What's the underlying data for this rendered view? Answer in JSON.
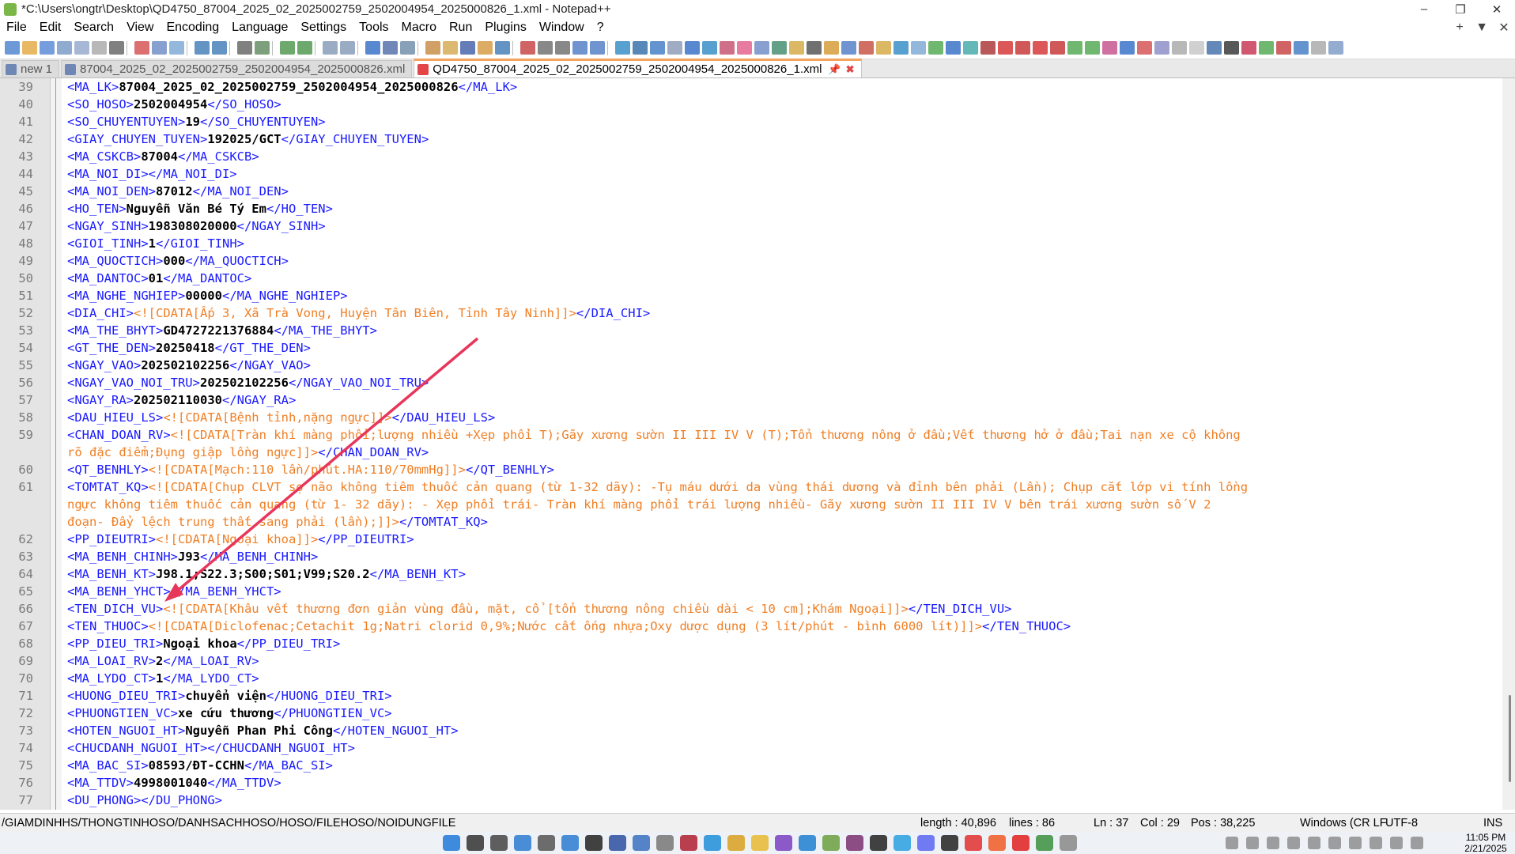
{
  "window": {
    "title": "*C:\\Users\\ongtr\\Desktop\\QD4750_87004_2025_02_2025002759_2502004954_2025000826_1.xml - Notepad++",
    "minimize": "–",
    "maximize": "❐",
    "close": "✕"
  },
  "menu": [
    "File",
    "Edit",
    "Search",
    "View",
    "Encoding",
    "Language",
    "Settings",
    "Tools",
    "Macro",
    "Run",
    "Plugins",
    "Window",
    "?"
  ],
  "menu_right": {
    "add": "+",
    "dropdown": "▼",
    "close": "✕"
  },
  "tabs": [
    {
      "label": "new 1"
    },
    {
      "label": "87004_2025_02_2025002759_2502004954_2025000826.xml"
    },
    {
      "label": "QD4750_87004_2025_02_2025002759_2502004954_2025000826_1.xml",
      "pin": "📌",
      "close": "✖"
    }
  ],
  "lines": [
    {
      "n": "39",
      "t": "MA_LK",
      "v": "87004_2025_02_2025002759_2502004954_2025000826"
    },
    {
      "n": "40",
      "t": "SO_HOSO",
      "v": "2502004954"
    },
    {
      "n": "41",
      "t": "SO_CHUYENTUYEN",
      "v": "19"
    },
    {
      "n": "42",
      "t": "GIAY_CHUYEN_TUYEN",
      "v": "192025/GCT"
    },
    {
      "n": "43",
      "t": "MA_CSKCB",
      "v": "87004"
    },
    {
      "n": "44",
      "t": "MA_NOI_DI",
      "v": ""
    },
    {
      "n": "45",
      "t": "MA_NOI_DEN",
      "v": "87012"
    },
    {
      "n": "46",
      "t": "HO_TEN",
      "v": "Nguyễn Văn Bé Tý Em"
    },
    {
      "n": "47",
      "t": "NGAY_SINH",
      "v": "198308020000"
    },
    {
      "n": "48",
      "t": "GIOI_TINH",
      "v": "1"
    },
    {
      "n": "49",
      "t": "MA_QUOCTICH",
      "v": "000"
    },
    {
      "n": "50",
      "t": "MA_DANTOC",
      "v": "01"
    },
    {
      "n": "51",
      "t": "MA_NGHE_NGHIEP",
      "v": "00000"
    },
    {
      "n": "52",
      "t": "DIA_CHI",
      "c": "<![CDATA[Ấp 3, Xã Trà Vong, Huyện Tân Biên, Tỉnh Tây Ninh]]>"
    },
    {
      "n": "53",
      "t": "MA_THE_BHYT",
      "v": "GD4727221376884"
    },
    {
      "n": "54",
      "t": "GT_THE_DEN",
      "v": "20250418"
    },
    {
      "n": "55",
      "t": "NGAY_VAO",
      "v": "202502102256"
    },
    {
      "n": "56",
      "t": "NGAY_VAO_NOI_TRU",
      "v": "202502102256"
    },
    {
      "n": "57",
      "t": "NGAY_RA",
      "v": "202502110030"
    },
    {
      "n": "58",
      "t": "DAU_HIEU_LS",
      "c": "<![CDATA[Bệnh tỉnh,nặng ngực]]>"
    },
    {
      "n": "59",
      "t": "CHAN_DOAN_RV",
      "c": "<![CDATA[Tràn khí màng phổi;lượng nhiều +Xẹp phổi T);Gãy xương sườn II III IV V (T);Tổn thương nông ở đầu;Vết thương hở ở đầu;Tai nạn xe cộ không",
      "c2": "rõ đặc điểm;Đụng giập lồng ngực]]>"
    },
    {
      "n": "60",
      "t": "QT_BENHLY",
      "c": "<![CDATA[Mạch:110 lần/phút.HA:110/70mmHg]]>"
    },
    {
      "n": "61",
      "t": "TOMTAT_KQ",
      "c": "<![CDATA[Chụp CLVT sọ não không tiêm thuốc cản quang (từ 1-32 dãy): -Tụ máu dưới da vùng thái dương và đỉnh bên phải (Lần); Chụp cắt lớp vi tính lồng",
      "c2": "ngực không tiêm thuốc cản quang (từ 1- 32 dãy): - Xẹp phổi trái- Tràn khí màng phổi trái lượng nhiều- Gãy xương sườn II III IV V bên trái xương sườn số V 2",
      "c3": "đoạn- Đẩy lệch trung thất sang phải (lần);]]>"
    },
    {
      "n": "62",
      "t": "PP_DIEUTRI",
      "c": "<![CDATA[Ngoại khoa]]>"
    },
    {
      "n": "63",
      "t": "MA_BENH_CHINH",
      "v": "J93"
    },
    {
      "n": "64",
      "t": "MA_BENH_KT",
      "v": "J98.1;S22.3;S00;S01;V99;S20.2"
    },
    {
      "n": "65",
      "t": "MA_BENH_YHCT",
      "v": ""
    },
    {
      "n": "66",
      "t": "TEN_DICH_VU",
      "c": "<![CDATA[Khâu vết thương đơn giản vùng đầu, mặt, cổ [tổn thương nông chiều dài < 10 cm];Khám Ngoại]]>"
    },
    {
      "n": "67",
      "t": "TEN_THUOC",
      "c": "<![CDATA[Diclofenac;Cetachit 1g;Natri clorid 0,9%;Nước cất ống nhựa;Oxy dược dụng (3 lít/phút - bình 6000 lít)]]>"
    },
    {
      "n": "68",
      "t": "PP_DIEU_TRI",
      "v": "Ngoại khoa"
    },
    {
      "n": "69",
      "t": "MA_LOAI_RV",
      "v": "2"
    },
    {
      "n": "70",
      "t": "MA_LYDO_CT",
      "v": "1"
    },
    {
      "n": "71",
      "t": "HUONG_DIEU_TRI",
      "v": "chuyển viện"
    },
    {
      "n": "72",
      "t": "PHUONGTIEN_VC",
      "v": "xe cứu thương"
    },
    {
      "n": "73",
      "t": "HOTEN_NGUOI_HT",
      "v": "Nguyễn Phan Phi Công"
    },
    {
      "n": "74",
      "t": "CHUCDANH_NGUOI_HT",
      "v": ""
    },
    {
      "n": "75",
      "t": "MA_BAC_SI",
      "v": "08593/ĐT-CCHN"
    },
    {
      "n": "76",
      "t": "MA_TTDV",
      "v": "4998001040"
    },
    {
      "n": "77",
      "t": "DU_PHONG",
      "v": ""
    }
  ],
  "status": {
    "path": "/GIAMDINHHS/THONGTINHOSO/DANHSACHHOSO/HOSO/FILEHOSO/NOIDUNGFILE",
    "length": "length : 40,896",
    "lines": "lines : 86",
    "ln": "Ln : 37",
    "col": "Col : 29",
    "pos": "Pos : 38,225",
    "eol": "Windows (CR LF",
    "encoding": "UTF-8",
    "ins": "INS"
  },
  "clock": {
    "time": "11:05 PM",
    "date": "2/21/2025"
  },
  "colors": {
    "tag": "#1a1aff",
    "cdata": "#f07f24",
    "arrow": "#e8365b",
    "active_tab": "#f4a460"
  }
}
